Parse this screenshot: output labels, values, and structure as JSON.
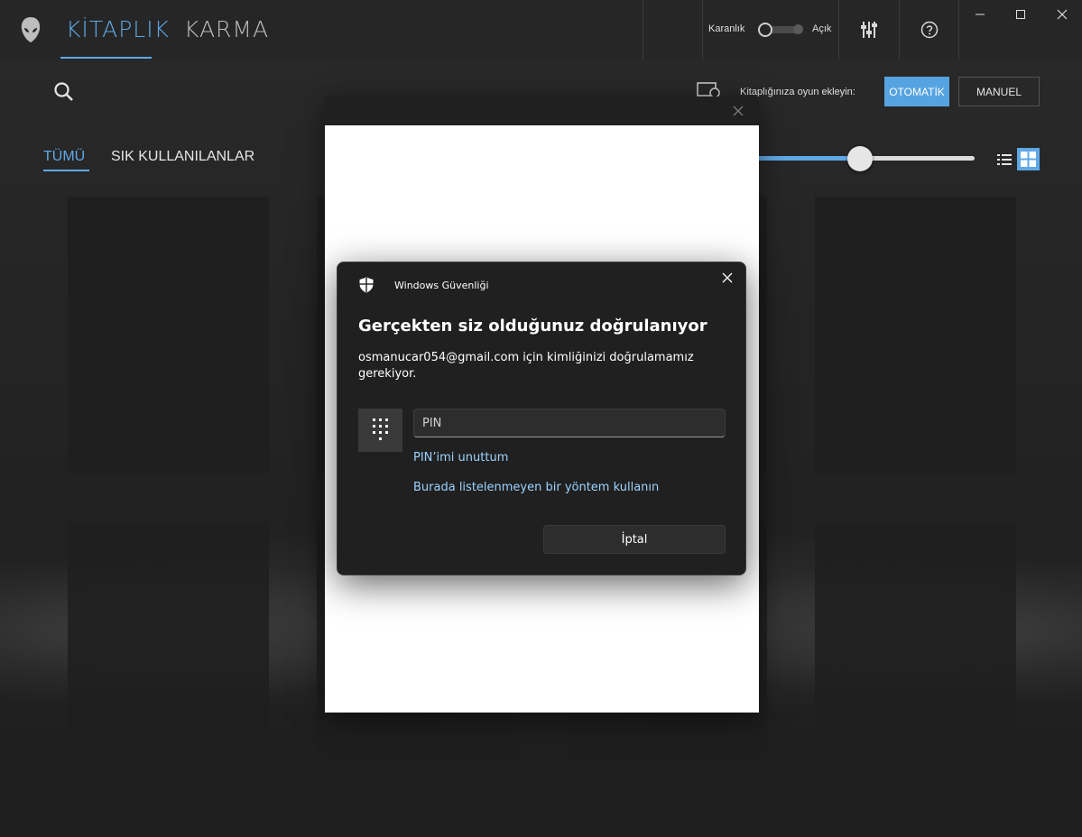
{
  "app": {
    "nav_tabs": [
      {
        "label": "KİTAPLIK",
        "active": true
      },
      {
        "label": "KARMA",
        "active": false
      }
    ],
    "theme": {
      "dark_label": "Karanlık",
      "light_label": "Açık"
    },
    "accent_color": "#5fa8e6"
  },
  "toolbar": {
    "add_games_label": "Kitaplığınıza oyun ekleyin:",
    "auto_button": "OTOMATİK",
    "manual_button": "MANUEL"
  },
  "filters": [
    {
      "label": "TÜMÜ",
      "active": true
    },
    {
      "label": "SIK KULLANILANLAR",
      "active": false
    }
  ],
  "tile_size_slider": {
    "value": 0.48
  },
  "dialog": {
    "app_name": "Windows Güvenliği",
    "title": "Gerçekten siz olduğunuz doğrulanıyor",
    "description": "osmanucar054@gmail.com için kimliğinizi doğrulamamız gerekiyor.",
    "pin_placeholder": "PIN",
    "forgot_pin_link": "PIN’imi unuttum",
    "other_method_link": "Burada listelenmeyen bir yöntem kullanın",
    "cancel_button": "İptal"
  }
}
